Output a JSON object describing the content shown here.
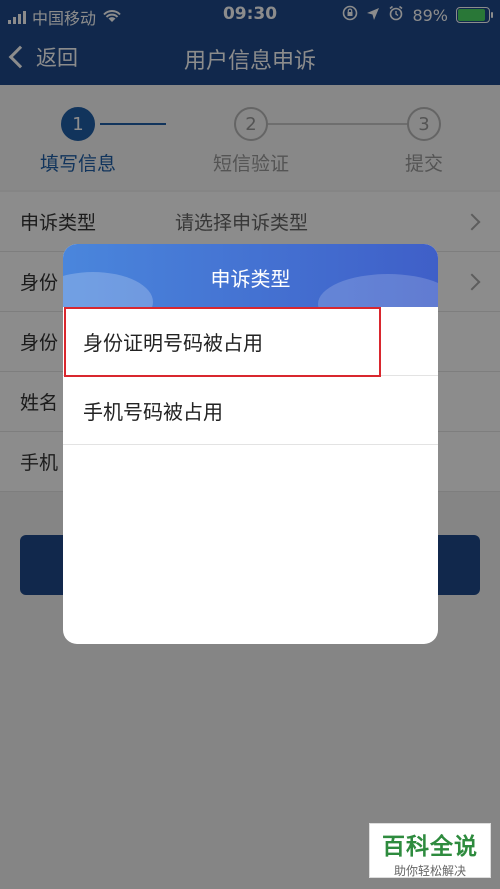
{
  "status": {
    "carrier": "中国移动",
    "time": "09:30",
    "battery": "89%",
    "battery_level": 0.89
  },
  "nav": {
    "back": "返回",
    "title": "用户信息申诉"
  },
  "steps": [
    {
      "num": "1",
      "label": "填写信息"
    },
    {
      "num": "2",
      "label": "短信验证"
    },
    {
      "num": "3",
      "label": "提交"
    }
  ],
  "form": {
    "rows": [
      {
        "label": "申诉类型",
        "value": "请选择申诉类型"
      },
      {
        "label": "身份"
      },
      {
        "label": "身份"
      },
      {
        "label": "姓名"
      },
      {
        "label": "手机"
      }
    ]
  },
  "dialog": {
    "title": "申诉类型",
    "options": [
      "身份证明号码被占用",
      "手机号码被占用"
    ]
  },
  "watermark": {
    "title": "百科全说",
    "subtitle": "助你轻松解决"
  }
}
